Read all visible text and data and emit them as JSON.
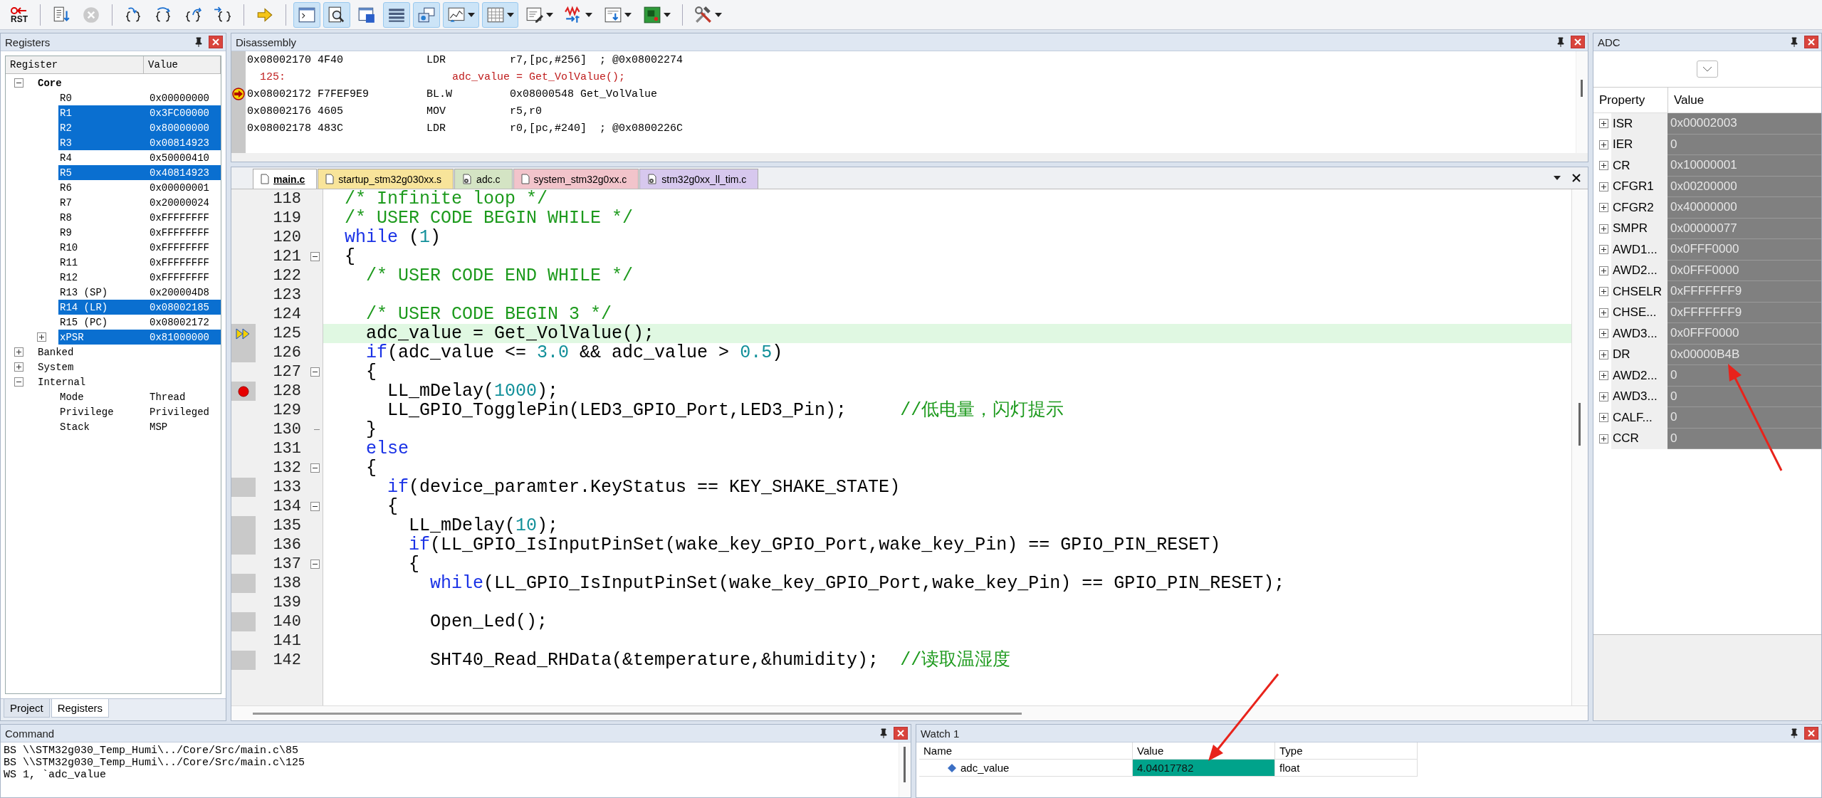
{
  "toolbar": [
    {
      "kind": "reset",
      "label": "RST",
      "on": false,
      "disabled": false,
      "dropdown": false
    },
    {
      "kind": "separator"
    },
    {
      "kind": "doc-arrow",
      "on": false,
      "disabled": false,
      "dropdown": false
    },
    {
      "kind": "stop",
      "on": false,
      "disabled": true,
      "dropdown": false
    },
    {
      "kind": "separator"
    },
    {
      "kind": "step-into",
      "on": false,
      "disabled": false,
      "dropdown": false
    },
    {
      "kind": "step-over",
      "on": false,
      "disabled": false,
      "dropdown": false
    },
    {
      "kind": "step-out",
      "on": false,
      "disabled": false,
      "dropdown": false
    },
    {
      "kind": "run-cursor",
      "on": false,
      "disabled": false,
      "dropdown": false
    },
    {
      "kind": "separator"
    },
    {
      "kind": "show-next",
      "on": false,
      "disabled": false,
      "dropdown": false
    },
    {
      "kind": "separator"
    },
    {
      "kind": "command",
      "on": true,
      "disabled": false,
      "dropdown": false
    },
    {
      "kind": "disassembly",
      "on": true,
      "disabled": false,
      "dropdown": false
    },
    {
      "kind": "symbols",
      "on": false,
      "disabled": false,
      "dropdown": false
    },
    {
      "kind": "registers",
      "on": true,
      "disabled": false,
      "dropdown": false
    },
    {
      "kind": "callstack",
      "on": true,
      "disabled": false,
      "dropdown": false
    },
    {
      "kind": "watch",
      "on": true,
      "disabled": false,
      "dropdown": true
    },
    {
      "kind": "memory",
      "on": true,
      "disabled": false,
      "dropdown": true
    },
    {
      "kind": "serial",
      "on": false,
      "disabled": false,
      "dropdown": true
    },
    {
      "kind": "analysis",
      "on": false,
      "disabled": false,
      "dropdown": true
    },
    {
      "kind": "trace",
      "on": false,
      "disabled": false,
      "dropdown": true
    },
    {
      "kind": "sysview",
      "on": false,
      "disabled": false,
      "dropdown": true
    },
    {
      "kind": "separator"
    },
    {
      "kind": "toolbox",
      "on": false,
      "disabled": false,
      "dropdown": true
    }
  ],
  "registers": {
    "title": "Registers",
    "columns": [
      "Register",
      "Value"
    ],
    "tree": [
      {
        "name": "Core",
        "bold": true,
        "expanded": true,
        "children": [
          {
            "name": "R0",
            "value": "0x00000000",
            "changed": false
          },
          {
            "name": "R1",
            "value": "0x3FC00000",
            "changed": true
          },
          {
            "name": "R2",
            "value": "0x80000000",
            "changed": true
          },
          {
            "name": "R3",
            "value": "0x00814923",
            "changed": true
          },
          {
            "name": "R4",
            "value": "0x50000410",
            "changed": false
          },
          {
            "name": "R5",
            "value": "0x40814923",
            "changed": true
          },
          {
            "name": "R6",
            "value": "0x00000001",
            "changed": false
          },
          {
            "name": "R7",
            "value": "0x20000024",
            "changed": false
          },
          {
            "name": "R8",
            "value": "0xFFFFFFFF",
            "changed": false
          },
          {
            "name": "R9",
            "value": "0xFFFFFFFF",
            "changed": false
          },
          {
            "name": "R10",
            "value": "0xFFFFFFFF",
            "changed": false
          },
          {
            "name": "R11",
            "value": "0xFFFFFFFF",
            "changed": false
          },
          {
            "name": "R12",
            "value": "0xFFFFFFFF",
            "changed": false
          },
          {
            "name": "R13 (SP)",
            "value": "0x200004D8",
            "changed": false
          },
          {
            "name": "R14 (LR)",
            "value": "0x08002185",
            "changed": true
          },
          {
            "name": "R15 (PC)",
            "value": "0x08002172",
            "changed": false
          },
          {
            "name": "xPSR",
            "value": "0x81000000",
            "changed": true,
            "expanded": false
          }
        ]
      },
      {
        "name": "Banked",
        "bold": false,
        "expanded": false
      },
      {
        "name": "System",
        "bold": false,
        "expanded": false
      },
      {
        "name": "Internal",
        "bold": false,
        "expanded": true,
        "children": [
          {
            "name": "Mode",
            "value": "Thread",
            "changed": false
          },
          {
            "name": "Privilege",
            "value": "Privileged",
            "changed": false
          },
          {
            "name": "Stack",
            "value": "MSP",
            "changed": false
          }
        ]
      }
    ],
    "tabs": [
      {
        "label": "Project",
        "selected": false
      },
      {
        "label": "Registers",
        "selected": true
      }
    ]
  },
  "disassembly": {
    "title": "Disassembly",
    "lines": [
      {
        "kind": "asm",
        "address": "0x08002170",
        "opcode": "4F40",
        "mnemonic": "LDR",
        "operands": "r7,[pc,#256]  ; @0x08002274",
        "current": false
      },
      {
        "kind": "source",
        "line": "125:",
        "text": "adc_value = Get_VolValue();"
      },
      {
        "kind": "asm",
        "address": "0x08002172",
        "opcode": "F7FEF9E9",
        "mnemonic": "BL.W",
        "operands": "0x08000548 Get_VolValue",
        "current": true
      },
      {
        "kind": "asm",
        "address": "0x08002176",
        "opcode": "4605",
        "mnemonic": "MOV",
        "operands": "r5,r0",
        "current": false
      },
      {
        "kind": "asm",
        "address": "0x08002178",
        "opcode": "483C",
        "mnemonic": "LDR",
        "operands": "r0,[pc,#240]  ; @0x0800226C",
        "current": false
      }
    ]
  },
  "editor": {
    "tabs": [
      {
        "label": "main.c",
        "selected": true,
        "color": "#ffffff",
        "kind": "file"
      },
      {
        "label": "startup_stm32g030xx.s",
        "selected": false,
        "color": "#f8e49a",
        "kind": "file"
      },
      {
        "label": "adc.c",
        "selected": false,
        "color": "#d4e4c4",
        "kind": "generated"
      },
      {
        "label": "system_stm32g0xx.c",
        "selected": false,
        "color": "#f2c4cb",
        "kind": "file"
      },
      {
        "label": "stm32g0xx_ll_tim.c",
        "selected": false,
        "color": "#d7c8ee",
        "kind": "generated"
      }
    ],
    "lines": [
      {
        "number": "118",
        "highlighted": false,
        "current": false,
        "breakpoint": false,
        "executable": false,
        "fold_start": false,
        "fold_end": false,
        "segments": [
          {
            "text": "/* Infinite loop */",
            "kind": "comment"
          }
        ]
      },
      {
        "number": "119",
        "highlighted": false,
        "current": false,
        "breakpoint": false,
        "executable": false,
        "fold_start": false,
        "fold_end": false,
        "segments": [
          {
            "text": "/* USER CODE BEGIN WHILE */",
            "kind": "comment"
          }
        ]
      },
      {
        "number": "120",
        "highlighted": false,
        "current": false,
        "breakpoint": false,
        "executable": false,
        "fold_start": false,
        "fold_end": false,
        "segments": [
          {
            "text": "while",
            "kind": "keyword"
          },
          {
            "text": " (",
            "kind": "plain"
          },
          {
            "text": "1",
            "kind": "number"
          },
          {
            "text": ")",
            "kind": "plain"
          }
        ]
      },
      {
        "number": "121",
        "highlighted": false,
        "current": false,
        "breakpoint": false,
        "executable": false,
        "fold_start": true,
        "fold_end": false,
        "segments": [
          {
            "text": "{",
            "kind": "plain"
          }
        ]
      },
      {
        "number": "122",
        "highlighted": false,
        "current": false,
        "breakpoint": false,
        "executable": false,
        "fold_start": false,
        "fold_end": false,
        "segments": [
          {
            "text": "  /* USER CODE END WHILE */",
            "kind": "comment"
          }
        ]
      },
      {
        "number": "123",
        "highlighted": false,
        "current": false,
        "breakpoint": false,
        "executable": false,
        "fold_start": false,
        "fold_end": false
      },
      {
        "number": "124",
        "highlighted": false,
        "current": false,
        "breakpoint": false,
        "executable": false,
        "fold_start": false,
        "fold_end": false,
        "segments": [
          {
            "text": "  /* USER CODE BEGIN 3 */",
            "kind": "comment"
          }
        ]
      },
      {
        "number": "125",
        "highlighted": true,
        "current": true,
        "breakpoint": false,
        "executable": true,
        "fold_start": false,
        "fold_end": false,
        "segments": [
          {
            "text": "  adc_value = Get_VolValue();",
            "kind": "plain"
          }
        ]
      },
      {
        "number": "126",
        "highlighted": false,
        "current": false,
        "breakpoint": false,
        "executable": true,
        "fold_start": false,
        "fold_end": false,
        "segments": [
          {
            "text": "  if",
            "kind": "keyword"
          },
          {
            "text": "(adc_value <= ",
            "kind": "plain"
          },
          {
            "text": "3.0",
            "kind": "number"
          },
          {
            "text": " && adc_value > ",
            "kind": "plain"
          },
          {
            "text": "0.5",
            "kind": "number"
          },
          {
            "text": ")",
            "kind": "plain"
          }
        ]
      },
      {
        "number": "127",
        "highlighted": false,
        "current": false,
        "breakpoint": false,
        "executable": false,
        "fold_start": true,
        "fold_end": false,
        "segments": [
          {
            "text": "  {",
            "kind": "plain"
          }
        ]
      },
      {
        "number": "128",
        "highlighted": false,
        "current": false,
        "breakpoint": true,
        "executable": true,
        "fold_start": false,
        "fold_end": false,
        "segments": [
          {
            "text": "    LL_mDelay(",
            "kind": "plain"
          },
          {
            "text": "1000",
            "kind": "number"
          },
          {
            "text": ");",
            "kind": "plain"
          }
        ]
      },
      {
        "number": "129",
        "highlighted": false,
        "current": false,
        "breakpoint": false,
        "executable": false,
        "fold_start": false,
        "fold_end": false,
        "segments": [
          {
            "text": "    LL_GPIO_TogglePin(LED3_GPIO_Port,LED3_Pin);     ",
            "kind": "plain"
          },
          {
            "text": "//低电量，闪灯提示",
            "kind": "comment"
          }
        ]
      },
      {
        "number": "130",
        "highlighted": false,
        "current": false,
        "breakpoint": false,
        "executable": false,
        "fold_start": false,
        "fold_end": true,
        "segments": [
          {
            "text": "  }",
            "kind": "plain"
          }
        ]
      },
      {
        "number": "131",
        "highlighted": false,
        "current": false,
        "breakpoint": false,
        "executable": false,
        "fold_start": false,
        "fold_end": false,
        "segments": [
          {
            "text": "  else",
            "kind": "keyword"
          }
        ]
      },
      {
        "number": "132",
        "highlighted": false,
        "current": false,
        "breakpoint": false,
        "executable": false,
        "fold_start": true,
        "fold_end": false,
        "segments": [
          {
            "text": "  {",
            "kind": "plain"
          }
        ]
      },
      {
        "number": "133",
        "highlighted": false,
        "current": false,
        "breakpoint": false,
        "executable": true,
        "fold_start": false,
        "fold_end": false,
        "segments": [
          {
            "text": "    if",
            "kind": "keyword"
          },
          {
            "text": "(device_paramter.KeyStatus == KEY_SHAKE_STATE)",
            "kind": "plain"
          }
        ]
      },
      {
        "number": "134",
        "highlighted": false,
        "current": false,
        "breakpoint": false,
        "executable": false,
        "fold_start": true,
        "fold_end": false,
        "segments": [
          {
            "text": "    {",
            "kind": "plain"
          }
        ]
      },
      {
        "number": "135",
        "highlighted": false,
        "current": false,
        "breakpoint": false,
        "executable": true,
        "fold_start": false,
        "fold_end": false,
        "segments": [
          {
            "text": "      LL_mDelay(",
            "kind": "plain"
          },
          {
            "text": "10",
            "kind": "number"
          },
          {
            "text": ");",
            "kind": "plain"
          }
        ]
      },
      {
        "number": "136",
        "highlighted": false,
        "current": false,
        "breakpoint": false,
        "executable": true,
        "fold_start": false,
        "fold_end": false,
        "segments": [
          {
            "text": "      if",
            "kind": "keyword"
          },
          {
            "text": "(LL_GPIO_IsInputPinSet(wake_key_GPIO_Port,wake_key_Pin) == GPIO_PIN_RESET)",
            "kind": "plain"
          }
        ]
      },
      {
        "number": "137",
        "highlighted": false,
        "current": false,
        "breakpoint": false,
        "executable": false,
        "fold_start": true,
        "fold_end": false,
        "segments": [
          {
            "text": "      {",
            "kind": "plain"
          }
        ]
      },
      {
        "number": "138",
        "highlighted": false,
        "current": false,
        "breakpoint": false,
        "executable": true,
        "fold_start": false,
        "fold_end": false,
        "segments": [
          {
            "text": "        while",
            "kind": "keyword"
          },
          {
            "text": "(LL_GPIO_IsInputPinSet(wake_key_GPIO_Port,wake_key_Pin) == GPIO_PIN_RESET);",
            "kind": "plain"
          }
        ]
      },
      {
        "number": "139",
        "highlighted": false,
        "current": false,
        "breakpoint": false,
        "executable": false,
        "fold_start": false,
        "fold_end": false
      },
      {
        "number": "140",
        "highlighted": false,
        "current": false,
        "breakpoint": false,
        "executable": true,
        "fold_start": false,
        "fold_end": false,
        "segments": [
          {
            "text": "        Open_Led();",
            "kind": "plain"
          }
        ]
      },
      {
        "number": "141",
        "highlighted": false,
        "current": false,
        "breakpoint": false,
        "executable": false,
        "fold_start": false,
        "fold_end": false
      },
      {
        "number": "142",
        "highlighted": false,
        "current": false,
        "breakpoint": false,
        "executable": true,
        "fold_start": false,
        "fold_end": false,
        "segments": [
          {
            "text": "        SHT40_Read_RHData(&temperature,&humidity);  ",
            "kind": "plain"
          },
          {
            "text": "//读取温湿度",
            "kind": "comment"
          }
        ]
      }
    ]
  },
  "adc": {
    "title": "ADC",
    "columns": [
      "Property",
      "Value"
    ],
    "rows": [
      {
        "name": "ISR",
        "value": "0x00002003",
        "expanded": false
      },
      {
        "name": "IER",
        "value": "0",
        "expanded": false
      },
      {
        "name": "CR",
        "value": "0x10000001",
        "expanded": false
      },
      {
        "name": "CFGR1",
        "value": "0x00200000",
        "expanded": false
      },
      {
        "name": "CFGR2",
        "value": "0x40000000",
        "expanded": false
      },
      {
        "name": "SMPR",
        "value": "0x00000077",
        "expanded": false
      },
      {
        "name": "AWD1...",
        "value": "0x0FFF0000",
        "expanded": false
      },
      {
        "name": "AWD2...",
        "value": "0x0FFF0000",
        "expanded": false
      },
      {
        "name": "CHSELR",
        "value": "0xFFFFFFF9",
        "expanded": false
      },
      {
        "name": "CHSE...",
        "value": "0xFFFFFFF9",
        "expanded": false
      },
      {
        "name": "AWD3...",
        "value": "0x0FFF0000",
        "expanded": false
      },
      {
        "name": "DR",
        "value": "0x00000B4B",
        "expanded": false
      },
      {
        "name": "AWD2...",
        "value": "0",
        "expanded": false
      },
      {
        "name": "AWD3...",
        "value": "0",
        "expanded": false
      },
      {
        "name": "CALF...",
        "value": "0",
        "expanded": false
      },
      {
        "name": "CCR",
        "value": "0",
        "expanded": false
      }
    ]
  },
  "command": {
    "title": "Command",
    "lines": [
      "BS \\\\STM32g030_Temp_Humi\\../Core/Src/main.c\\85",
      "BS \\\\STM32g030_Temp_Humi\\../Core/Src/main.c\\125",
      "WS 1, `adc_value"
    ]
  },
  "watch": {
    "title": "Watch 1",
    "columns": [
      "Name",
      "Value",
      "Type"
    ],
    "rows": [
      {
        "name": "adc_value",
        "value": "4.04017782",
        "type": "float",
        "changed": true
      }
    ]
  }
}
